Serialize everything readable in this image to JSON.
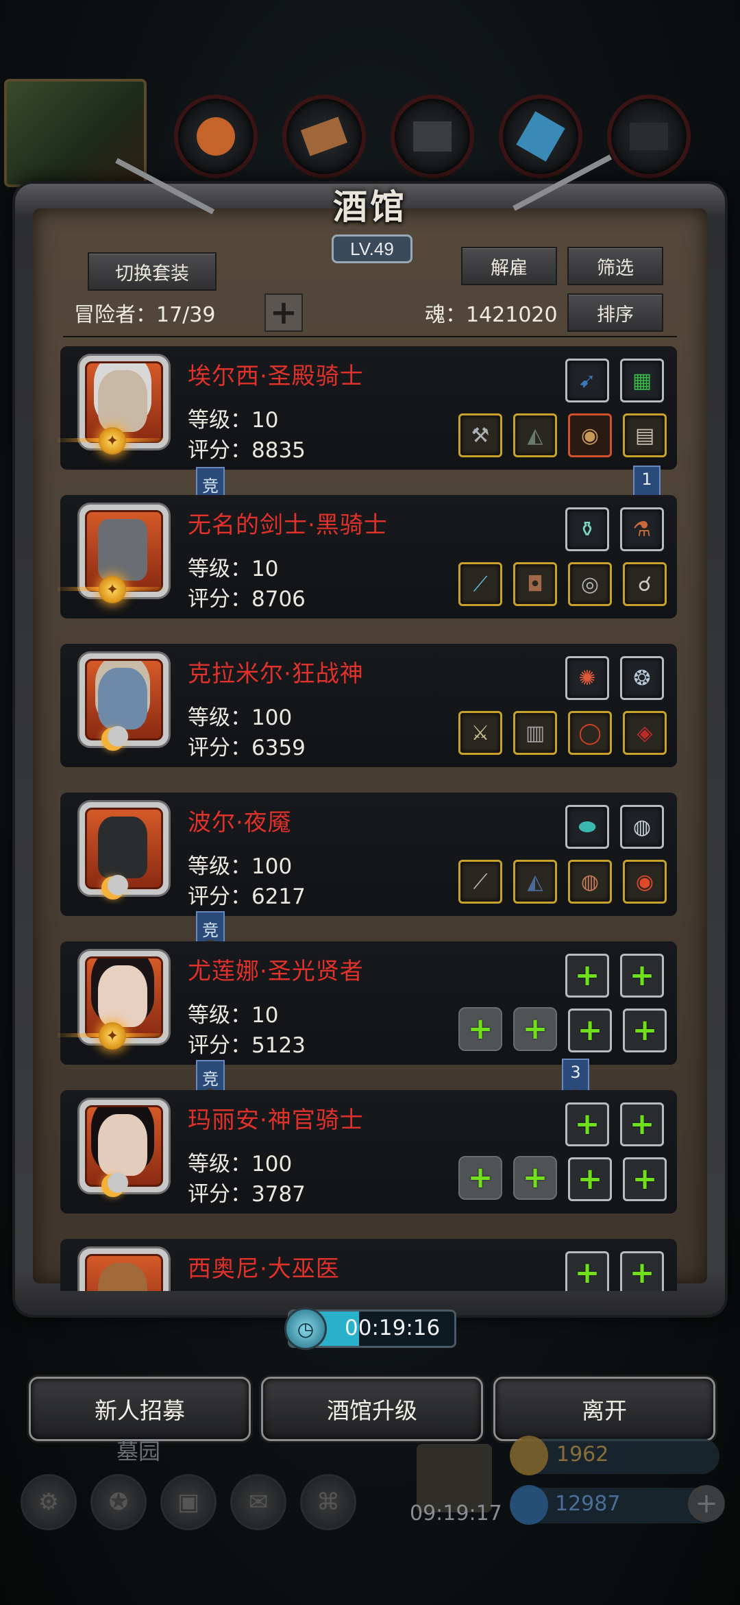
{
  "title": "酒馆",
  "level_badge": "LV.49",
  "buttons": {
    "switch_set": "切换套装",
    "dismiss": "解雇",
    "filter": "筛选",
    "sort": "排序",
    "add_adventurer": "+"
  },
  "adventurer_count": "冒险者：17/39",
  "soul": "魂：1421020",
  "heroes": [
    {
      "name": "埃尔西·圣殿骑士",
      "level": "等级：10",
      "score": "评分：8835",
      "emblem": "gear",
      "face": "#c9b8a4",
      "hair": "#d8d8d8"
    },
    {
      "name": "无名的剑士·黑骑士",
      "level": "等级：10",
      "score": "评分：8706",
      "emblem": "gear",
      "face": "#6a6e72",
      "hair": "#3a3c3e"
    },
    {
      "name": "克拉米尔·狂战神",
      "level": "等级：100",
      "score": "评分：6359",
      "emblem": "crescent",
      "face": "#6f8aa8",
      "hair": "#c8bca8"
    },
    {
      "name": "波尔·夜魇",
      "level": "等级：100",
      "score": "评分：6217",
      "emblem": "crescent",
      "face": "#2a2c2e",
      "hair": "#1a1b1c"
    },
    {
      "name": "尤莲娜·圣光贤者",
      "level": "等级：10",
      "score": "评分：5123",
      "emblem": "gear",
      "face": "#e8d0c0",
      "hair": "#1a1416"
    },
    {
      "name": "玛丽安·神官骑士",
      "level": "等级：100",
      "score": "评分：3787",
      "emblem": "crescent",
      "face": "#e4ccbc",
      "hair": "#141012"
    },
    {
      "name": "西奥尼·大巫医",
      "level": "",
      "score": "",
      "emblem": "",
      "face": "#a06a3a",
      "hair": "#5a3a1a"
    }
  ],
  "tags": {
    "jing": "竞",
    "num_1": "1",
    "num_3": "3"
  },
  "timer": "00:19:16",
  "bottom_buttons": {
    "recruit": "新人招募",
    "upgrade": "酒馆升级",
    "leave": "离开"
  },
  "background": {
    "cemetery": "墓园",
    "gift_timer": "09:19:17",
    "gold": "1962",
    "gems": "12987"
  },
  "colors": {
    "hero_name": "#e0312a",
    "slot_gold": "#c9a22a",
    "plus_green": "#6fe01a",
    "timer_fill": "#2ab0c8"
  }
}
